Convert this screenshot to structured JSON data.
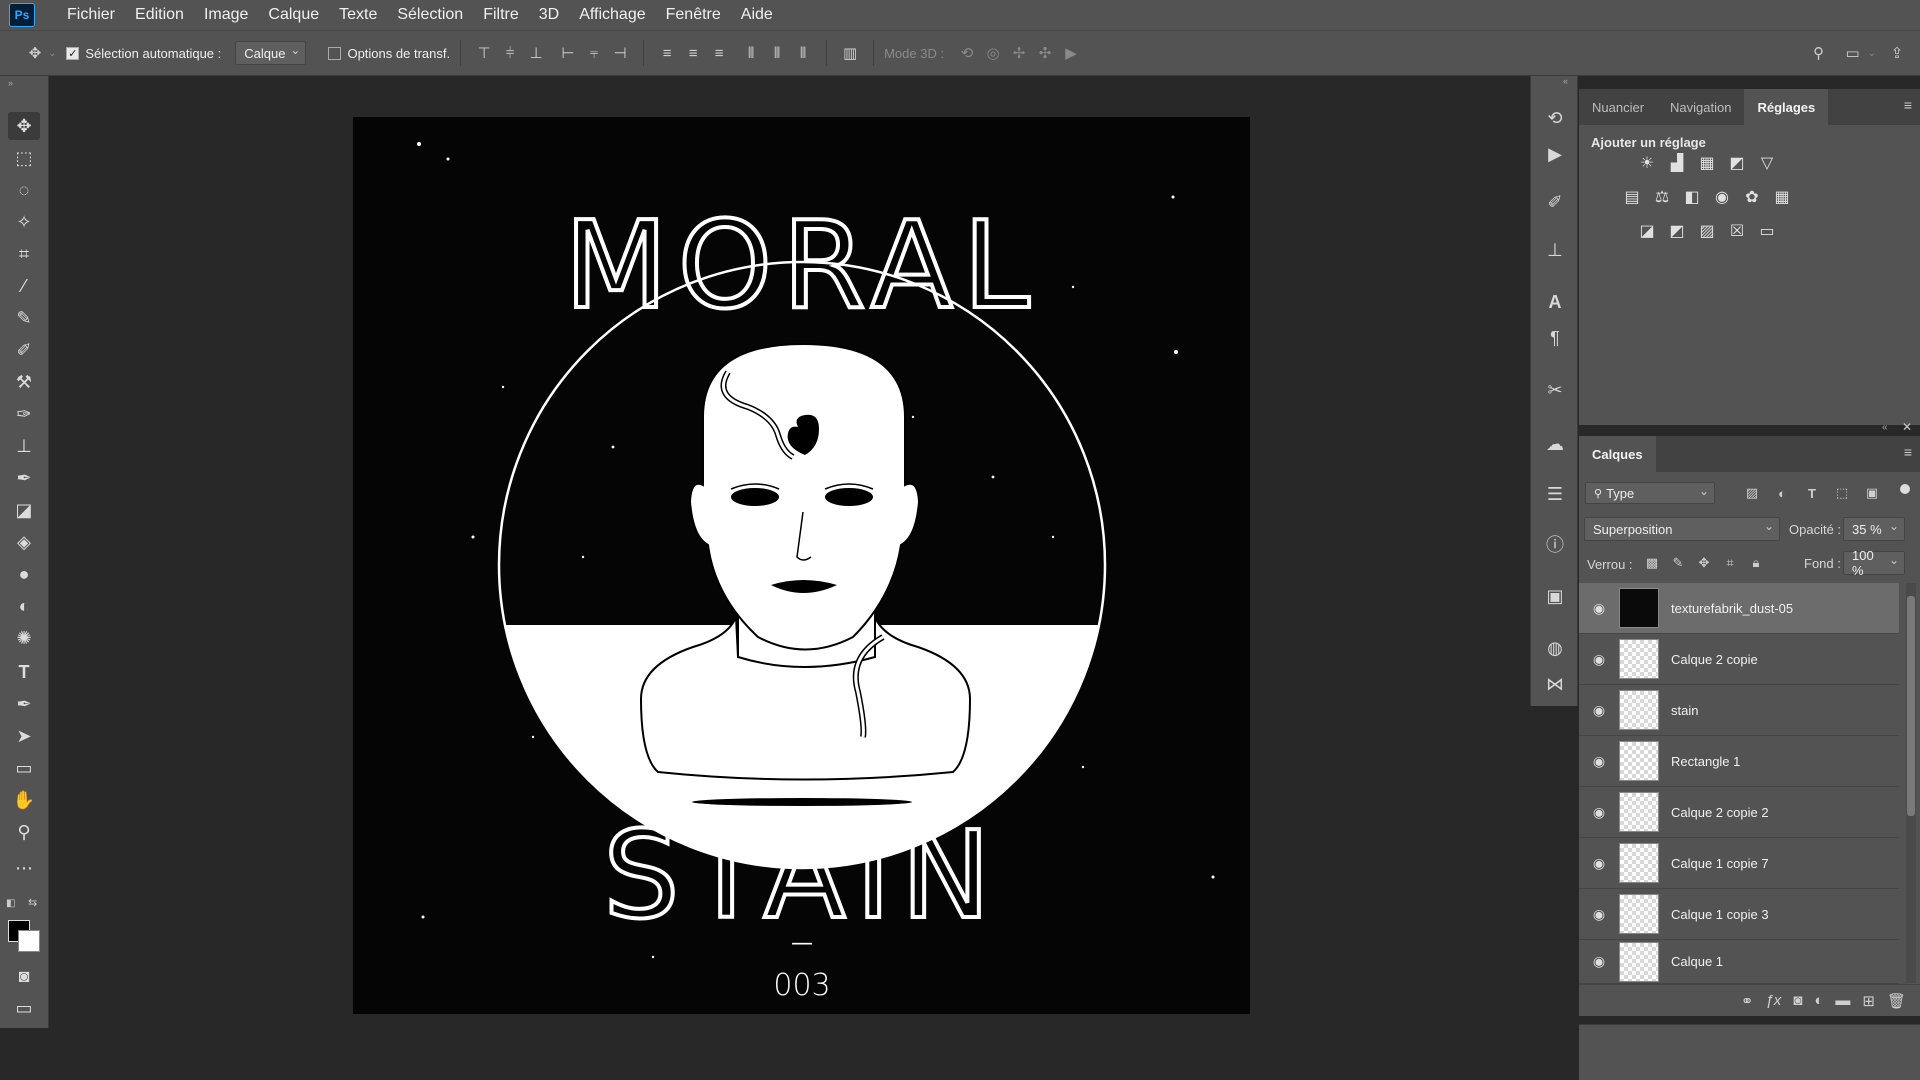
{
  "app": {
    "logo_text": "Ps"
  },
  "menu": [
    "Fichier",
    "Edition",
    "Image",
    "Calque",
    "Texte",
    "Sélection",
    "Filtre",
    "3D",
    "Affichage",
    "Fenêtre",
    "Aide"
  ],
  "options_bar": {
    "auto_select_label": "Sélection automatique :",
    "auto_select_checked": true,
    "target_value": "Calque",
    "transform_controls_label": "Options de transf.",
    "mode_3d_label": "Mode 3D :"
  },
  "artwork": {
    "title_line1": "MORAL",
    "title_line2": "STAIN",
    "dash": "—",
    "number": "003"
  },
  "adjustments_panel": {
    "tabs": [
      "Nuancier",
      "Navigation",
      "Réglages"
    ],
    "active_tab": "Réglages",
    "heading": "Ajouter un réglage",
    "icons": [
      "brightness-icon",
      "levels-icon",
      "curves-icon",
      "exposure-icon",
      "vibrance-icon",
      "hue-saturation-icon",
      "color-balance-icon",
      "black-white-icon",
      "photo-filter-icon",
      "channel-mixer-icon",
      "color-lookup-icon",
      "invert-icon",
      "posterize-icon",
      "threshold-icon",
      "selective-color-icon",
      "gradient-map-icon"
    ]
  },
  "layers_panel": {
    "tab": "Calques",
    "filter_value": "Type",
    "blend_mode": "Superposition",
    "opacity_label": "Opacité :",
    "opacity_value": "35 %",
    "lock_label": "Verrou :",
    "fill_label": "Fond :",
    "fill_value": "100 %",
    "layers": [
      {
        "name": "texturefabrik_dust-05",
        "selected": true,
        "thumb": "dark"
      },
      {
        "name": "Calque 2 copie",
        "selected": false,
        "thumb": "transparent"
      },
      {
        "name": "stain",
        "selected": false,
        "thumb": "transparent"
      },
      {
        "name": "Rectangle 1",
        "selected": false,
        "thumb": "transparent"
      },
      {
        "name": "Calque 2 copie 2",
        "selected": false,
        "thumb": "transparent"
      },
      {
        "name": "Calque 1 copie 7",
        "selected": false,
        "thumb": "transparent"
      },
      {
        "name": "Calque 1 copie 3",
        "selected": false,
        "thumb": "transparent"
      },
      {
        "name": "Calque 1",
        "selected": false,
        "thumb": "transparent"
      }
    ]
  }
}
